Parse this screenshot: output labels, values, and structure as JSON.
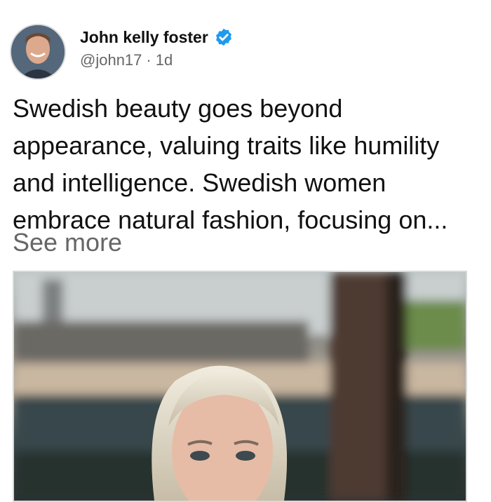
{
  "post": {
    "author_name": "John kelly foster",
    "handle": "@john17",
    "separator": "·",
    "time": "1d",
    "text_lines": [
      "Swedish beauty goes beyond",
      "appearance, valuing traits like humility",
      "and intelligence. Swedish women",
      "embrace natural fashion, focusing on..."
    ],
    "see_more": "See more"
  },
  "icons": {
    "avatar": "avatar-photo",
    "verified": "verified-badge-icon",
    "media": "post-image-woman"
  },
  "colors": {
    "verified_blue": "#1d9bf0",
    "muted_text": "#666666",
    "text": "#111111"
  }
}
